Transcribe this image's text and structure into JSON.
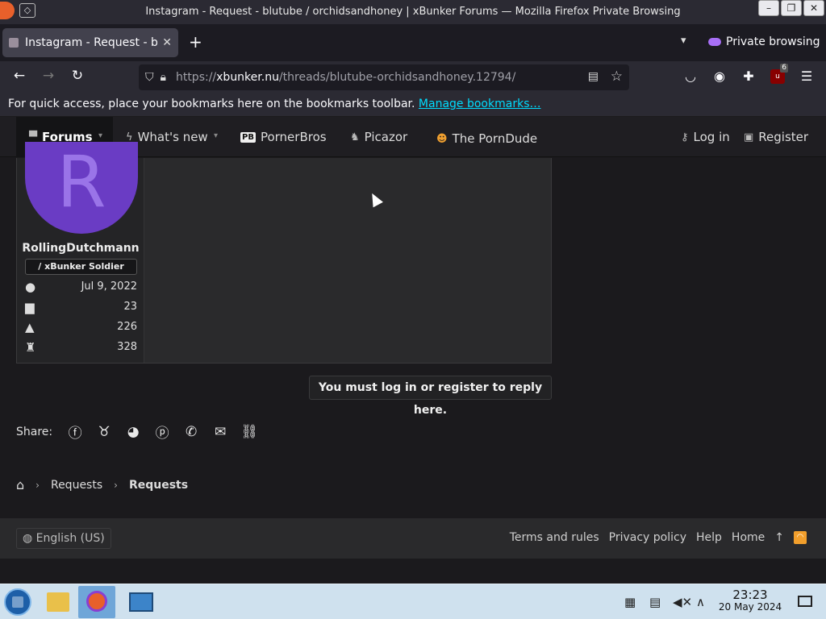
{
  "window": {
    "title": "Instagram - Request - blutube / orchidsandhoney | xBunker Forums — Mozilla Firefox Private Browsing",
    "minimize": "–",
    "maximize": "❐",
    "close": "✕"
  },
  "tabs": [
    {
      "label": "Instagram - Request - blutube"
    }
  ],
  "tabstrip": {
    "new_tab": "+",
    "list_all": "⌄",
    "private_label": "Private browsing"
  },
  "nav": {
    "back": "←",
    "forward": "→",
    "reload": "↻",
    "url_prefix": "https://",
    "url_domain": "xbunker.nu",
    "url_path": "/threads/blutube-orchidsandhoney.12794/",
    "ublock_count": "6"
  },
  "bookmarks_bar": {
    "text": "For quick access, place your bookmarks here on the bookmarks toolbar.",
    "link": "Manage bookmarks…"
  },
  "forum_nav": {
    "forums": "Forums",
    "whats_new": "What's new",
    "pornerbros": "PornerBros",
    "pornerbros_badge": "PB",
    "picazor": "Picazor",
    "porndude": "The PornDude",
    "log_in": "Log in",
    "register": "Register"
  },
  "post": {
    "avatar_letter": "R",
    "username": "RollingDutchmann",
    "user_title": "xBunker Soldier",
    "stats": [
      {
        "icon": "user-icon",
        "value": "Jul 9, 2022"
      },
      {
        "icon": "messages-icon",
        "value": "23"
      },
      {
        "icon": "reactions-icon",
        "value": "226"
      },
      {
        "icon": "trophy-icon",
        "value": "328"
      }
    ]
  },
  "reply_notice": "You must log in or register to reply here.",
  "share": {
    "label": "Share:",
    "services": [
      "facebook",
      "twitter",
      "reddit",
      "pinterest",
      "whatsapp",
      "email",
      "link"
    ]
  },
  "breadcrumbs": [
    "Requests",
    "Requests"
  ],
  "footer": {
    "language": "English (US)",
    "links": [
      "Terms and rules",
      "Privacy policy",
      "Help",
      "Home"
    ]
  },
  "taskbar": {
    "time": "23:23",
    "date": "20 May 2024"
  },
  "colors": {
    "avatar": "#6a3cc4",
    "accent_link": "#00ddff",
    "private_mask": "#a86ff7"
  }
}
